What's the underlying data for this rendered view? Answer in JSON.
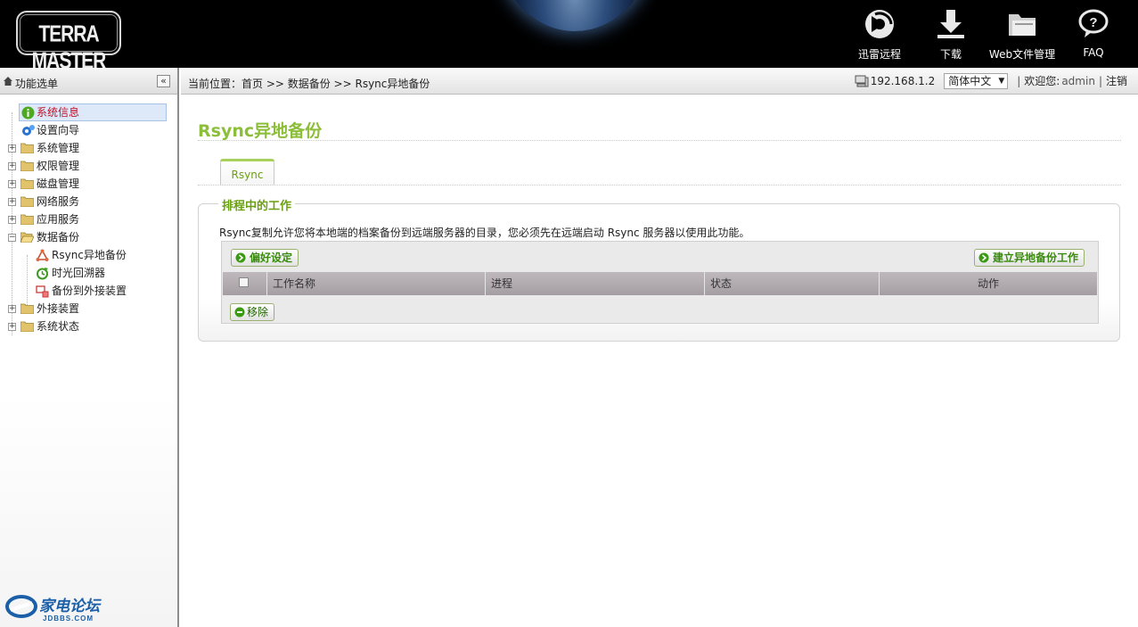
{
  "header": {
    "logo_text": "TERRA MASTER",
    "buttons": [
      {
        "label": "迅雷远程",
        "icon": "thunder-remote-icon"
      },
      {
        "label": "下载",
        "icon": "download-icon"
      },
      {
        "label": "Web文件管理",
        "icon": "folder-icon"
      },
      {
        "label": "FAQ",
        "icon": "question-icon"
      }
    ]
  },
  "sidebar": {
    "title": "功能选单",
    "collapse": "«",
    "items": [
      {
        "label": "系统信息",
        "selected": true
      },
      {
        "label": "设置向导"
      },
      {
        "label": "系统管理",
        "expand": "+"
      },
      {
        "label": "权限管理",
        "expand": "+"
      },
      {
        "label": "磁盘管理",
        "expand": "+"
      },
      {
        "label": "网络服务",
        "expand": "+"
      },
      {
        "label": "应用服务",
        "expand": "+"
      },
      {
        "label": "数据备份",
        "expand": "−"
      },
      {
        "label": "Rsync异地备份",
        "child": true
      },
      {
        "label": "时光回溯器",
        "child": true
      },
      {
        "label": "备份到外接装置",
        "child": true
      },
      {
        "label": "外接装置",
        "expand": "+"
      },
      {
        "label": "系统状态",
        "expand": "+"
      }
    ],
    "footer_logo": {
      "text": "家电论坛",
      "subtext": "JDBBS.COM"
    }
  },
  "topbar": {
    "breadcrumb": "当前位置：首页 >> 数据备份 >> Rsync异地备份",
    "ip": "192.168.1.2",
    "language": "简体中文",
    "welcome": "欢迎您:",
    "user": "admin",
    "logout": "注销"
  },
  "main": {
    "title": "Rsync异地备份",
    "tab": "Rsync",
    "legend": "排程中的工作",
    "description": "Rsync复制允许您将本地端的档案备份到远端服务器的目录，您必须先在远端启动 Rsync 服务器以使用此功能。",
    "buttons": {
      "preferences": "偏好设定",
      "create": "建立异地备份工作",
      "remove": "移除"
    },
    "columns": [
      "工作名称",
      "进程",
      "状态",
      "动作"
    ]
  },
  "colors": {
    "accent_green": "#8cbe3a",
    "legend_green": "#6aa012",
    "selected_red": "#c0102a"
  }
}
